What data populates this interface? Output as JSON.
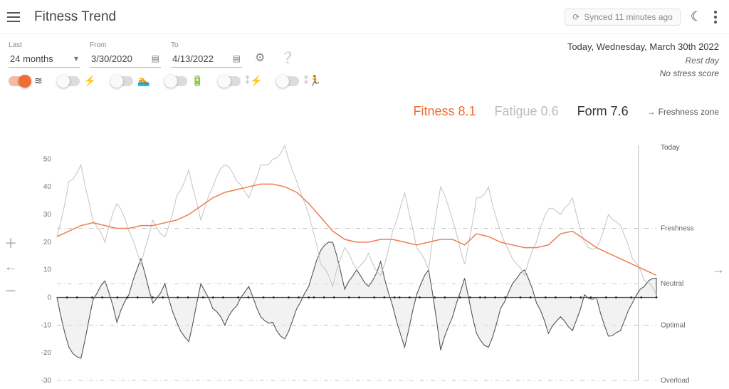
{
  "header": {
    "title": "Fitness Trend",
    "sync_text": "Synced 11 minutes ago"
  },
  "range": {
    "last_label": "Last",
    "last_value": "24 months",
    "from_label": "From",
    "from_value": "3/30/2020",
    "to_label": "To",
    "to_value": "4/13/2022"
  },
  "today": {
    "line": "Today, Wednesday, March 30th 2022",
    "rest": "Rest day",
    "stress": "No stress score"
  },
  "toggles": [
    {
      "id": "fitness",
      "on": true,
      "glyph": "≋",
      "faded": false
    },
    {
      "id": "power",
      "on": false,
      "glyph": "⚡",
      "faded": false
    },
    {
      "id": "swim",
      "on": false,
      "glyph": "🏊",
      "faded": false
    },
    {
      "id": "battery",
      "on": false,
      "glyph": "🔋",
      "faded": false
    },
    {
      "id": "hr-power",
      "on": false,
      "glyph": "⁑⚡",
      "faded": true
    },
    {
      "id": "hr-run",
      "on": false,
      "glyph": "⁑🏃",
      "faded": true
    }
  ],
  "metrics": {
    "fitness_label": "Fitness 8.1",
    "fatigue_label": "Fatigue 0.6",
    "form_label": "Form 7.6",
    "freshzone_label": "Freshness zone"
  },
  "chart_axis": {
    "yticks": [
      50,
      40,
      30,
      20,
      10,
      0,
      -10,
      -20,
      -30
    ],
    "zones": [
      {
        "label": "Freshness",
        "y": 25
      },
      {
        "label": "Neutral",
        "y": 5
      },
      {
        "label": "Optimal",
        "y": -10
      },
      {
        "label": "Overload",
        "y": -30
      }
    ],
    "today_label": "Today"
  },
  "chart_data": {
    "type": "line",
    "title": "Fitness Trend",
    "xlabel": "",
    "ylabel": "",
    "ylim": [
      -30,
      55
    ],
    "x_range": [
      "2020-03-30",
      "2022-04-13"
    ],
    "zones": [
      {
        "name": "Freshness",
        "y": 25
      },
      {
        "name": "Neutral",
        "y": 5
      },
      {
        "name": "Optimal",
        "y": -10
      },
      {
        "name": "Overload",
        "y": -30
      }
    ],
    "current": {
      "fitness": 8.1,
      "fatigue": 0.6,
      "form": 7.6
    },
    "x": [
      0,
      0.02,
      0.04,
      0.06,
      0.08,
      0.1,
      0.12,
      0.14,
      0.16,
      0.18,
      0.2,
      0.22,
      0.24,
      0.26,
      0.28,
      0.3,
      0.32,
      0.34,
      0.36,
      0.38,
      0.4,
      0.42,
      0.44,
      0.46,
      0.48,
      0.5,
      0.52,
      0.54,
      0.56,
      0.58,
      0.6,
      0.62,
      0.64,
      0.66,
      0.68,
      0.7,
      0.72,
      0.74,
      0.76,
      0.78,
      0.8,
      0.82,
      0.84,
      0.86,
      0.88,
      0.9,
      0.92,
      0.94,
      0.96,
      0.98,
      1.0
    ],
    "series": [
      {
        "name": "Fitness",
        "color": "#ef7d4f",
        "values": [
          22,
          24,
          26,
          27,
          26,
          25,
          25,
          26,
          26,
          27,
          28,
          30,
          33,
          36,
          38,
          39,
          40,
          41,
          41,
          40,
          38,
          34,
          29,
          24,
          21,
          20,
          20,
          21,
          21,
          20,
          19,
          20,
          21,
          21,
          19,
          23,
          22,
          20,
          19,
          18,
          18,
          19,
          23,
          24,
          21,
          18,
          16,
          14,
          12,
          10,
          8
        ]
      },
      {
        "name": "Fatigue",
        "color": "#c8c8c8",
        "values": [
          22,
          42,
          48,
          28,
          20,
          34,
          24,
          12,
          28,
          22,
          37,
          46,
          28,
          40,
          48,
          42,
          36,
          48,
          50,
          55,
          42,
          30,
          12,
          4,
          18,
          10,
          16,
          8,
          24,
          38,
          18,
          10,
          40,
          28,
          12,
          36,
          40,
          24,
          14,
          8,
          20,
          32,
          30,
          36,
          20,
          18,
          30,
          26,
          14,
          6,
          1
        ]
      },
      {
        "name": "Form",
        "color": "#555",
        "values": [
          0,
          -18,
          -22,
          -1,
          6,
          -9,
          1,
          14,
          -2,
          5,
          -9,
          -16,
          5,
          -4,
          -10,
          -3,
          4,
          -7,
          -9,
          -15,
          -4,
          4,
          17,
          20,
          3,
          10,
          4,
          13,
          -3,
          -18,
          1,
          10,
          -19,
          -7,
          7,
          -13,
          -18,
          -4,
          5,
          10,
          -2,
          -13,
          -7,
          -12,
          1,
          0,
          -14,
          -12,
          -2,
          4,
          7
        ]
      }
    ]
  }
}
